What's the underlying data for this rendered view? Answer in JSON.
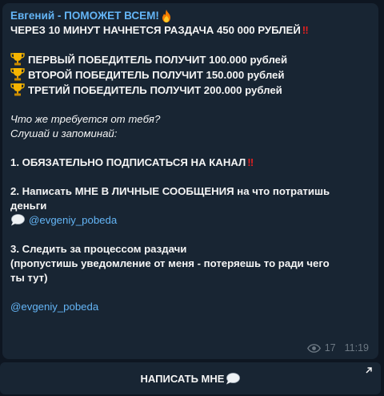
{
  "message": {
    "sender": "Евгений - ПОМОЖЕТ ВСЕМ!",
    "headline": "ЧЕРЕЗ 10 МИНУТ НАЧНЕТСЯ РАЗДАЧА 450 000 РУБЛЕЙ",
    "prizes": [
      "ПЕРВЫЙ ПОБЕДИТЕЛЬ ПОЛУЧИТ 100.000 рублей",
      "ВТОРОЙ ПОБЕДИТЕЛЬ ПОЛУЧИТ 150.000 рублей",
      "ТРЕТИЙ ПОБЕДИТЕЛЬ ПОЛУЧИТ 200.000 рублей"
    ],
    "question_line1": "Что же требуется от тебя?",
    "question_line2": "Слушай и запоминай:",
    "step1": "1. ОБЯЗАТЕЛЬНО ПОДПИСАТЬСЯ НА КАНАЛ",
    "step2_line1": "2. Написать  МНЕ В ЛИЧНЫЕ СООБЩЕНИЯ на что потратишь",
    "step2_line2": "деньги",
    "step2_link": "@evgeniy_pobeda",
    "step3_line1": "3. Следить за процессом раздачи",
    "step3_line2": "(пропустишь уведомление от меня - потеряешь то ради чего",
    "step3_line3": "ты тут)",
    "footer_link": "@evgeniy_pobeda",
    "views": "17",
    "time": "11:19"
  },
  "button": {
    "label": "НАПИСАТЬ МНЕ"
  },
  "icons": {
    "fire": "fire-emoji",
    "trophy": "trophy-emoji",
    "speech": "speech-bubble-emoji",
    "double_exclamation": "double-exclamation-emoji",
    "eye": "eye-icon",
    "arrow": "external-arrow-icon"
  },
  "colors": {
    "background": "#0e1621",
    "bubble": "#182533",
    "link": "#64b5f6",
    "meta": "#6c7883",
    "exclamation": "#e02020"
  }
}
